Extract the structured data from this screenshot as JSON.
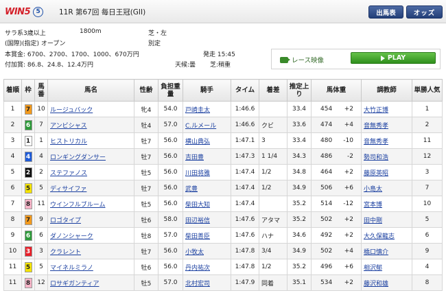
{
  "header": {
    "logo_main": "WIN",
    "logo_num": "5",
    "race_number": "5",
    "race_title": "11R 第67回 毎日王冠(GII)",
    "btn_entries": "出馬表",
    "btn_odds": "オッズ"
  },
  "info": {
    "class_line": "サラ系3歳以上",
    "distance": "1800m",
    "surface": "芝・左",
    "conditions": "(国際)(指定) オープン",
    "weight_rule": "別定",
    "prize_money": "本賞金: 6700、2700、1700、1000、670万円",
    "start_time": "発走 15:45",
    "added_money": "付加賞: 86.8、24.8、12.4万円",
    "weather": "天候:曇",
    "track_condition": "芝:稍重"
  },
  "replay": {
    "label": "レース映像",
    "play": "PLAY",
    "icon": "video-camera-icon",
    "play_color": "#3aa325"
  },
  "table": {
    "headers": {
      "finish": "着順",
      "bracket": "枠",
      "horse_no": "馬番",
      "horse": "馬名",
      "sex_age": "性齢",
      "weight_carried": "負担重量",
      "jockey": "騎手",
      "time": "タイム",
      "margin": "着差",
      "last3f": "推定上り",
      "body_weight": "馬体重",
      "trainer": "調教師",
      "popularity": "単勝人気"
    },
    "rows": [
      {
        "finish": "1",
        "bracket": "7",
        "no": "10",
        "horse": "ルージュバック",
        "sex_age": "牝4",
        "weight": "54.0",
        "jockey": "戸崎圭太",
        "time": "1:46.6",
        "margin": "",
        "last3f": "33.4",
        "bw": "454",
        "bw_diff": "+2",
        "trainer": "大竹正博",
        "pop": "1"
      },
      {
        "finish": "2",
        "bracket": "6",
        "no": "7",
        "horse": "アンビシャス",
        "sex_age": "牡4",
        "weight": "57.0",
        "jockey": "C.ルメール",
        "time": "1:46.6",
        "margin": "クビ",
        "last3f": "33.6",
        "bw": "474",
        "bw_diff": "+4",
        "trainer": "音無秀孝",
        "pop": "2"
      },
      {
        "finish": "3",
        "bracket": "1",
        "no": "1",
        "horse": "ヒストリカル",
        "sex_age": "牡7",
        "weight": "56.0",
        "jockey": "横山典弘",
        "time": "1:47.1",
        "margin": "3",
        "last3f": "33.4",
        "bw": "480",
        "bw_diff": "-10",
        "trainer": "音無秀孝",
        "pop": "11"
      },
      {
        "finish": "4",
        "bracket": "4",
        "no": "4",
        "horse": "ロンギングダンサー",
        "sex_age": "牡7",
        "weight": "56.0",
        "jockey": "吉田豊",
        "time": "1:47.3",
        "margin": "1 1/4",
        "last3f": "34.3",
        "bw": "486",
        "bw_diff": "-2",
        "trainer": "勢司和浩",
        "pop": "12"
      },
      {
        "finish": "5",
        "bracket": "2",
        "no": "2",
        "horse": "ステファノス",
        "sex_age": "牡5",
        "weight": "56.0",
        "jockey": "川田将雅",
        "time": "1:47.4",
        "margin": "1/2",
        "last3f": "34.8",
        "bw": "464",
        "bw_diff": "+2",
        "trainer": "藤原英昭",
        "pop": "3"
      },
      {
        "finish": "6",
        "bracket": "5",
        "no": "5",
        "horse": "ディサイファ",
        "sex_age": "牡7",
        "weight": "56.0",
        "jockey": "武豊",
        "time": "1:47.4",
        "margin": "1/2",
        "last3f": "34.9",
        "bw": "506",
        "bw_diff": "+6",
        "trainer": "小島太",
        "pop": "7"
      },
      {
        "finish": "7",
        "bracket": "8",
        "no": "11",
        "horse": "ウインフルブルーム",
        "sex_age": "牡5",
        "weight": "56.0",
        "jockey": "柴田大知",
        "time": "1:47.4",
        "margin": "",
        "last3f": "35.2",
        "bw": "514",
        "bw_diff": "-12",
        "trainer": "宮本博",
        "pop": "10"
      },
      {
        "finish": "8",
        "bracket": "7",
        "no": "9",
        "horse": "ロゴタイプ",
        "sex_age": "牡6",
        "weight": "58.0",
        "jockey": "田辺裕信",
        "time": "1:47.6",
        "margin": "アタマ",
        "last3f": "35.2",
        "bw": "502",
        "bw_diff": "+2",
        "trainer": "田中剛",
        "pop": "5"
      },
      {
        "finish": "9",
        "bracket": "6",
        "no": "6",
        "horse": "ダノンシャーク",
        "sex_age": "牡8",
        "weight": "57.0",
        "jockey": "柴田善臣",
        "time": "1:47.6",
        "margin": "ハナ",
        "last3f": "34.6",
        "bw": "492",
        "bw_diff": "+2",
        "trainer": "大久保龍志",
        "pop": "6"
      },
      {
        "finish": "10",
        "bracket": "3",
        "no": "3",
        "horse": "クラレント",
        "sex_age": "牡7",
        "weight": "56.0",
        "jockey": "小牧太",
        "time": "1:47.8",
        "margin": "3/4",
        "last3f": "34.9",
        "bw": "502",
        "bw_diff": "+4",
        "trainer": "橋口慎介",
        "pop": "9"
      },
      {
        "finish": "11",
        "bracket": "5",
        "no": "5",
        "horse": "マイネルミラノ",
        "sex_age": "牡6",
        "weight": "56.0",
        "jockey": "丹内祐次",
        "time": "1:47.8",
        "margin": "1/2",
        "last3f": "35.2",
        "bw": "496",
        "bw_diff": "+6",
        "trainer": "相沢郁",
        "pop": "4"
      },
      {
        "finish": "11",
        "bracket": "8",
        "no": "12",
        "horse": "ロサギガンティア",
        "sex_age": "牡5",
        "weight": "57.0",
        "jockey": "北村宏司",
        "time": "1:47.9",
        "margin": "同着",
        "last3f": "35.1",
        "bw": "534",
        "bw_diff": "+2",
        "trainer": "藤沢和雄",
        "pop": "8"
      }
    ]
  },
  "bracket_colors": {
    "1": {
      "bg": "#ffffff",
      "fg": "#222222"
    },
    "2": {
      "bg": "#111111",
      "fg": "#ffffff"
    },
    "3": {
      "bg": "#e8202a",
      "fg": "#ffffff"
    },
    "4": {
      "bg": "#1e5bd8",
      "fg": "#ffffff"
    },
    "5": {
      "bg": "#f5e400",
      "fg": "#222222"
    },
    "6": {
      "bg": "#2e9a3a",
      "fg": "#ffffff"
    },
    "7": {
      "bg": "#f39a1d",
      "fg": "#222222"
    },
    "8": {
      "bg": "#f7b5c8",
      "fg": "#222222"
    }
  }
}
